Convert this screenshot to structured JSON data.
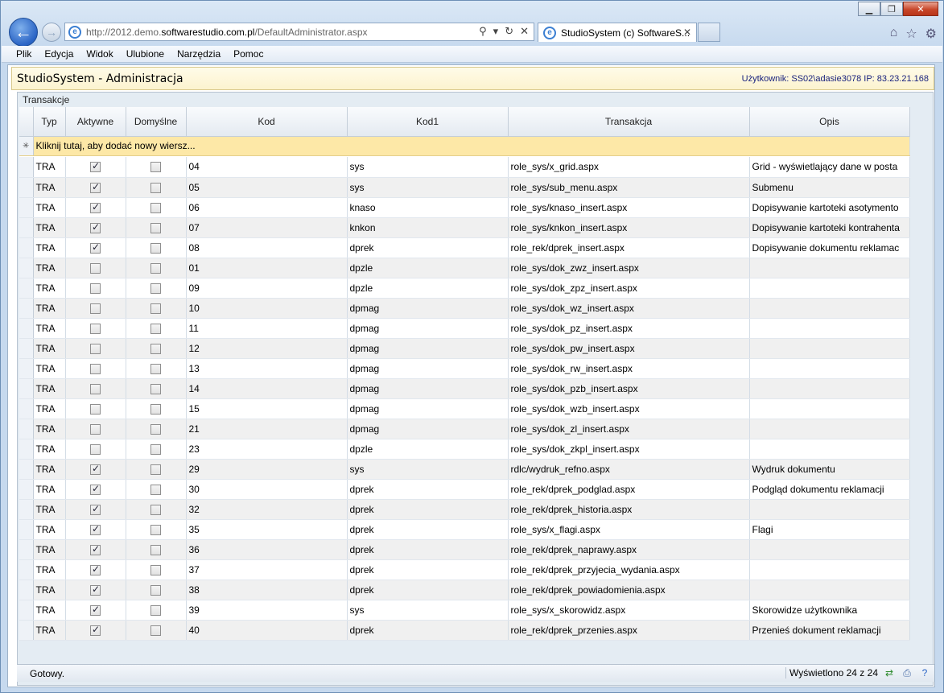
{
  "browser": {
    "address_prefix": "http://2012.demo.",
    "address_domain": "softwarestudio.com.pl",
    "address_path": "/DefaultAdministrator.aspx",
    "tab_title": "StudioSystem (c) SoftwareS..."
  },
  "menu": [
    "Plik",
    "Edycja",
    "Widok",
    "Ulubione",
    "Narzędzia",
    "Pomoc"
  ],
  "app": {
    "title": "StudioSystem - Administracja",
    "user_info": "Użytkownik: SS02\\adasie3078 IP: 83.23.21.168"
  },
  "grid": {
    "caption": "Transakcje",
    "columns": [
      "Typ",
      "Aktywne",
      "Domyślne",
      "Kod",
      "Kod1",
      "Transakcja",
      "Opis"
    ],
    "new_row_text": "Kliknij tutaj, aby dodać nowy wiersz...",
    "rows": [
      {
        "typ": "TRA",
        "aktywne": true,
        "domyslne": false,
        "kod": "04",
        "kod1": "sys",
        "transakcja": "role_sys/x_grid.aspx",
        "opis": "Grid - wyświetlający dane w posta"
      },
      {
        "typ": "TRA",
        "aktywne": true,
        "domyslne": false,
        "kod": "05",
        "kod1": "sys",
        "transakcja": "role_sys/sub_menu.aspx",
        "opis": "Submenu"
      },
      {
        "typ": "TRA",
        "aktywne": true,
        "domyslne": false,
        "kod": "06",
        "kod1": "knaso",
        "transakcja": "role_sys/knaso_insert.aspx",
        "opis": "Dopisywanie kartoteki asotymento"
      },
      {
        "typ": "TRA",
        "aktywne": true,
        "domyslne": false,
        "kod": "07",
        "kod1": "knkon",
        "transakcja": "role_sys/knkon_insert.aspx",
        "opis": "Dopisywanie kartoteki kontrahenta"
      },
      {
        "typ": "TRA",
        "aktywne": true,
        "domyslne": false,
        "kod": "08",
        "kod1": "dprek",
        "transakcja": "role_rek/dprek_insert.aspx",
        "opis": "Dopisywanie dokumentu reklamac"
      },
      {
        "typ": "TRA",
        "aktywne": false,
        "domyslne": false,
        "kod": "01",
        "kod1": "dpzle",
        "transakcja": "role_sys/dok_zwz_insert.aspx",
        "opis": ""
      },
      {
        "typ": "TRA",
        "aktywne": false,
        "domyslne": false,
        "kod": "09",
        "kod1": "dpzle",
        "transakcja": "role_sys/dok_zpz_insert.aspx",
        "opis": ""
      },
      {
        "typ": "TRA",
        "aktywne": false,
        "domyslne": false,
        "kod": "10",
        "kod1": "dpmag",
        "transakcja": "role_sys/dok_wz_insert.aspx",
        "opis": ""
      },
      {
        "typ": "TRA",
        "aktywne": false,
        "domyslne": false,
        "kod": "11",
        "kod1": "dpmag",
        "transakcja": "role_sys/dok_pz_insert.aspx",
        "opis": ""
      },
      {
        "typ": "TRA",
        "aktywne": false,
        "domyslne": false,
        "kod": "12",
        "kod1": "dpmag",
        "transakcja": "role_sys/dok_pw_insert.aspx",
        "opis": ""
      },
      {
        "typ": "TRA",
        "aktywne": false,
        "domyslne": false,
        "kod": "13",
        "kod1": "dpmag",
        "transakcja": "role_sys/dok_rw_insert.aspx",
        "opis": ""
      },
      {
        "typ": "TRA",
        "aktywne": false,
        "domyslne": false,
        "kod": "14",
        "kod1": "dpmag",
        "transakcja": "role_sys/dok_pzb_insert.aspx",
        "opis": ""
      },
      {
        "typ": "TRA",
        "aktywne": false,
        "domyslne": false,
        "kod": "15",
        "kod1": "dpmag",
        "transakcja": "role_sys/dok_wzb_insert.aspx",
        "opis": ""
      },
      {
        "typ": "TRA",
        "aktywne": false,
        "domyslne": false,
        "kod": "21",
        "kod1": "dpmag",
        "transakcja": "role_sys/dok_zl_insert.aspx",
        "opis": ""
      },
      {
        "typ": "TRA",
        "aktywne": false,
        "domyslne": false,
        "kod": "23",
        "kod1": "dpzle",
        "transakcja": "role_sys/dok_zkpl_insert.aspx",
        "opis": ""
      },
      {
        "typ": "TRA",
        "aktywne": true,
        "domyslne": false,
        "kod": "29",
        "kod1": "sys",
        "transakcja": "rdlc/wydruk_refno.aspx",
        "opis": "Wydruk dokumentu"
      },
      {
        "typ": "TRA",
        "aktywne": true,
        "domyslne": false,
        "kod": "30",
        "kod1": "dprek",
        "transakcja": "role_rek/dprek_podglad.aspx",
        "opis": "Podgląd dokumentu reklamacji"
      },
      {
        "typ": "TRA",
        "aktywne": true,
        "domyslne": false,
        "kod": "32",
        "kod1": "dprek",
        "transakcja": "role_rek/dprek_historia.aspx",
        "opis": ""
      },
      {
        "typ": "TRA",
        "aktywne": true,
        "domyslne": false,
        "kod": "35",
        "kod1": "dprek",
        "transakcja": "role_sys/x_flagi.aspx",
        "opis": "Flagi"
      },
      {
        "typ": "TRA",
        "aktywne": true,
        "domyslne": false,
        "kod": "36",
        "kod1": "dprek",
        "transakcja": "role_rek/dprek_naprawy.aspx",
        "opis": ""
      },
      {
        "typ": "TRA",
        "aktywne": true,
        "domyslne": false,
        "kod": "37",
        "kod1": "dprek",
        "transakcja": "role_rek/dprek_przyjecia_wydania.aspx",
        "opis": ""
      },
      {
        "typ": "TRA",
        "aktywne": true,
        "domyslne": false,
        "kod": "38",
        "kod1": "dprek",
        "transakcja": "role_rek/dprek_powiadomienia.aspx",
        "opis": ""
      },
      {
        "typ": "TRA",
        "aktywne": true,
        "domyslne": false,
        "kod": "39",
        "kod1": "sys",
        "transakcja": "role_sys/x_skorowidz.aspx",
        "opis": "Skorowidze użytkownika"
      },
      {
        "typ": "TRA",
        "aktywne": true,
        "domyslne": false,
        "kod": "40",
        "kod1": "dprek",
        "transakcja": "role_rek/dprek_przenies.aspx",
        "opis": "Przenieś dokument reklamacji"
      }
    ]
  },
  "status": {
    "text": "Gotowy.",
    "count": "Wyświetlono 24 z 24"
  }
}
